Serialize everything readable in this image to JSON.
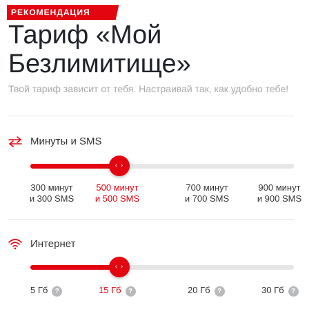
{
  "badge": "РЕКОМЕНДАЦИЯ",
  "title_line1": "Тариф «Мой",
  "title_line2": "Безлимитище»",
  "subtitle": "Твой тариф зависит от тебя. Настраивай так, как удобно тебе!",
  "colors": {
    "accent": "#e30611",
    "track": "#e6e6e6",
    "muted": "#a7a9ac"
  },
  "minutes": {
    "icon": "exchange-arrows-icon",
    "label": "Минуты и SMS",
    "selected_index": 1,
    "knob_icon": "‹ ›",
    "options": [
      {
        "line1": "300 минут",
        "line2": "и 300 SMS"
      },
      {
        "line1": "500 минут",
        "line2": "и 500 SMS"
      },
      {
        "line1": "700 минут",
        "line2": "и 700 SMS"
      },
      {
        "line1": "900 минут",
        "line2": "и 900 SMS"
      }
    ]
  },
  "internet": {
    "icon": "wifi-icon",
    "label": "Интернет",
    "selected_index": 1,
    "knob_icon": "‹ ›",
    "help_icon": "?",
    "options": [
      {
        "label": "5 Гб"
      },
      {
        "label": "15 Гб"
      },
      {
        "label": "20 Гб"
      },
      {
        "label": "30 Гб"
      }
    ]
  }
}
